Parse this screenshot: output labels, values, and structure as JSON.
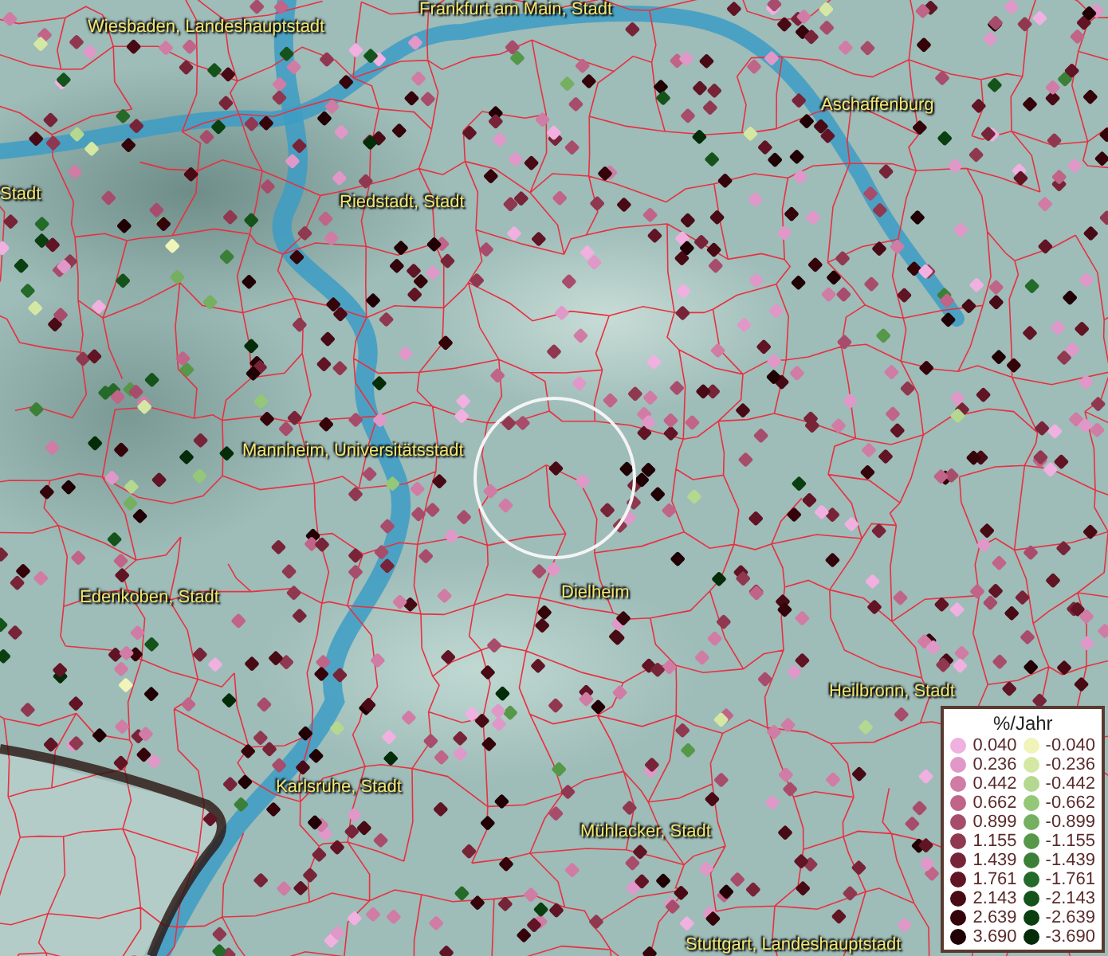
{
  "map": {
    "places": [
      {
        "name": "Wiesbaden, Landeshauptstadt"
      },
      {
        "name": "Frankfurt am Main, Stadt"
      },
      {
        "name": "Aschaffenburg"
      },
      {
        "name": "Stadt"
      },
      {
        "name": "Riedstadt, Stadt"
      },
      {
        "name": "Mannheim, Universitätsstadt"
      },
      {
        "name": "Edenkoben, Stadt"
      },
      {
        "name": "Dielheim"
      },
      {
        "name": "Heilbronn, Stadt"
      },
      {
        "name": "Karlsruhe, Stadt"
      },
      {
        "name": "Mühlacker, Stadt"
      },
      {
        "name": "Stuttgart, Landeshauptstadt"
      }
    ]
  },
  "legend": {
    "title": "%/Jahr",
    "positive": [
      {
        "value": "0.040",
        "color": "#f0b0e0"
      },
      {
        "value": "0.236",
        "color": "#e098c8"
      },
      {
        "value": "0.442",
        "color": "#d07ca4"
      },
      {
        "value": "0.662",
        "color": "#c06488"
      },
      {
        "value": "0.899",
        "color": "#a84c6c"
      },
      {
        "value": "1.155",
        "color": "#903850"
      },
      {
        "value": "1.439",
        "color": "#782438"
      },
      {
        "value": "1.761",
        "color": "#601424"
      },
      {
        "value": "2.143",
        "color": "#480a14"
      },
      {
        "value": "2.639",
        "color": "#34040a"
      },
      {
        "value": "3.690",
        "color": "#200004"
      }
    ],
    "negative": [
      {
        "value": "-0.040",
        "color": "#f0f4b8"
      },
      {
        "value": "-0.236",
        "color": "#d4e8a4"
      },
      {
        "value": "-0.442",
        "color": "#b4d890"
      },
      {
        "value": "-0.662",
        "color": "#94c878"
      },
      {
        "value": "-0.899",
        "color": "#74b060"
      },
      {
        "value": "-1.155",
        "color": "#549848"
      },
      {
        "value": "-1.439",
        "color": "#3c8038"
      },
      {
        "value": "-1.761",
        "color": "#246a28"
      },
      {
        "value": "-2.143",
        "color": "#14541a"
      },
      {
        "value": "-2.639",
        "color": "#0a4010"
      },
      {
        "value": "-3.690",
        "color": "#042c08"
      }
    ]
  }
}
